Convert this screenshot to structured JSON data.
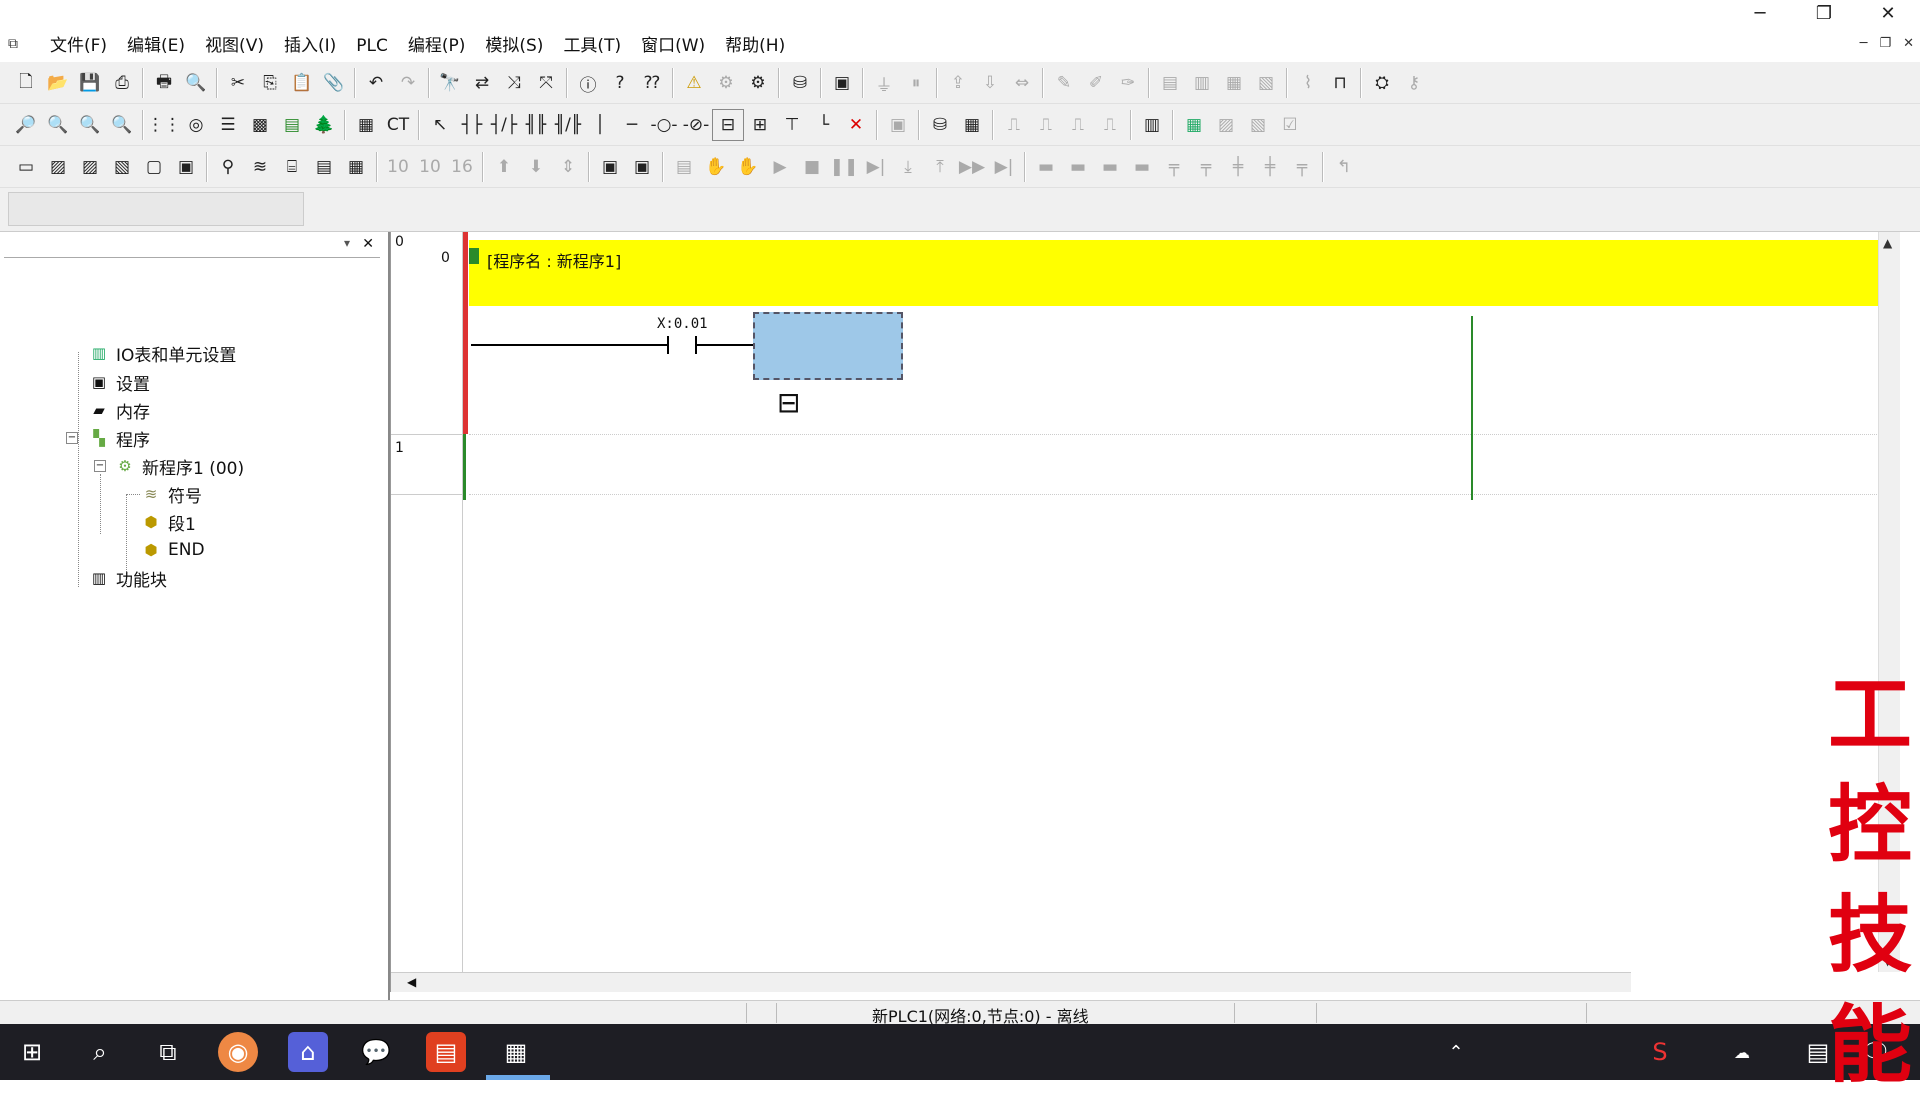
{
  "menu": {
    "items": [
      "文件(F)",
      "编辑(E)",
      "视图(V)",
      "插入(I)",
      "PLC",
      "编程(P)",
      "模拟(S)",
      "工具(T)",
      "窗口(W)",
      "帮助(H)"
    ]
  },
  "window_controls": {
    "minimize": "─",
    "restore": "❐",
    "close": "✕"
  },
  "tree": {
    "items": [
      {
        "label": "IO表和单元设置",
        "icon": "io-table-icon"
      },
      {
        "label": "设置",
        "icon": "settings-icon"
      },
      {
        "label": "内存",
        "icon": "memory-icon"
      },
      {
        "label": "程序",
        "icon": "programs-icon"
      },
      {
        "label": "新程序1 (00)",
        "icon": "program-icon"
      },
      {
        "label": "符号",
        "icon": "symbols-icon"
      },
      {
        "label": "段1",
        "icon": "section-icon"
      },
      {
        "label": "END",
        "icon": "section-icon"
      },
      {
        "label": "功能块",
        "icon": "function-block-icon"
      }
    ]
  },
  "editor": {
    "rung0_number": "0",
    "rung0_step": "0",
    "rung1_number": "1",
    "program_comment": "[程序名 : 新程序1]",
    "contact_address": "X:0.01"
  },
  "status": {
    "text": "新PLC1(网络:0,节点:0) - 离线"
  },
  "watermark": {
    "chars": [
      "工",
      "控",
      "技",
      "能"
    ]
  }
}
